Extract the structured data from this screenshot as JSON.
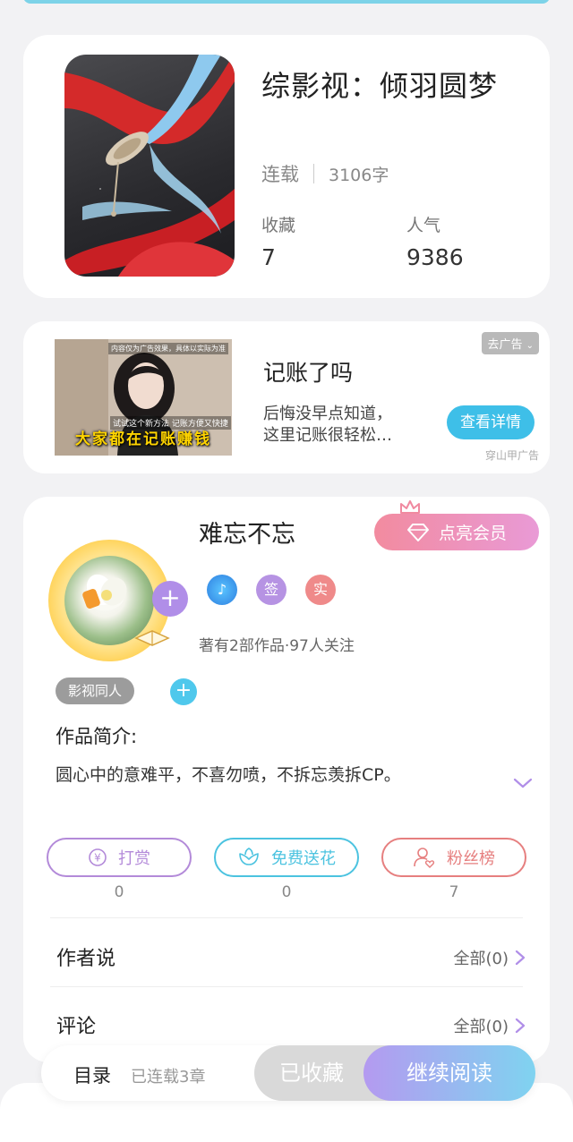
{
  "book": {
    "title": "综影视：倾羽圆梦",
    "status": "连载",
    "word_count": "3106字",
    "favorites_label": "收藏",
    "favorites_value": "7",
    "popularity_label": "人气",
    "popularity_value": "9386"
  },
  "ad": {
    "remove_label": "去广告",
    "title": "记账了吗",
    "desc_line1": "后悔没早点知道，",
    "desc_line2": "这里记账很轻松…",
    "cta": "查看详情",
    "source": "穿山甲广告",
    "image_caption": "大家都在记账赚钱",
    "image_subcaption": "试试这个新方法 记账方便又快捷",
    "image_top_caption": "内容仅为广告效果，具体以实际为准"
  },
  "author": {
    "name": "难忘不忘",
    "vip_label": "点亮会员",
    "badge_sign": "签",
    "badge_real": "实",
    "stats": "著有2部作品·97人关注",
    "genre_tag": "影视同人",
    "intro_label": "作品简介:",
    "intro_text": "圆心中的意难平，不喜勿喷，不拆忘羡拆CP。"
  },
  "actions": [
    {
      "label": "打赏",
      "count": "0",
      "color": "#b38ad9"
    },
    {
      "label": "免费送花",
      "count": "0",
      "color": "#4cc3e0"
    },
    {
      "label": "粉丝榜",
      "count": "7",
      "color": "#e67f7f"
    }
  ],
  "rows": {
    "author_say": "作者说",
    "author_say_more": "全部(0)",
    "comments": "评论",
    "comments_more": "全部(0)"
  },
  "bottom": {
    "toc": "目录",
    "chapters": "已连载3章",
    "collected": "已收藏",
    "continue": "继续阅读"
  }
}
